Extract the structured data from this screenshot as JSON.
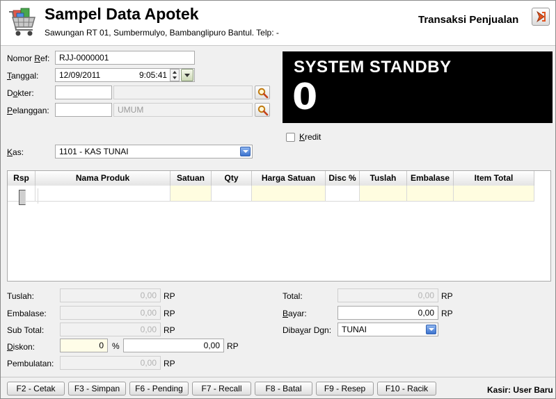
{
  "header": {
    "title": "Sampel Data Apotek",
    "subtitle": "Sawungan RT 01, Sumbermulyo, Bambanglipuro Bantul. Telp: -",
    "transaction_title": "Transaksi Penjualan",
    "logo_icon": "shopping-cart-icon",
    "exit_icon": "exit-arrow-icon"
  },
  "form": {
    "ref_label_pre": "Nomor ",
    "ref_label_key": "R",
    "ref_label_post": "ef:",
    "ref_value": "RJJ-0000001",
    "date_label_key": "T",
    "date_label_post": "anggal:",
    "date_value": "12/09/2011",
    "time_value": "9:05:41",
    "doctor_label_pre": "D",
    "doctor_label_key": "o",
    "doctor_label_post": "kter:",
    "doctor_code": "",
    "doctor_name": "",
    "customer_label_key": "P",
    "customer_label_post": "elanggan:",
    "customer_code": "",
    "customer_name": "UMUM",
    "kas_label_key": "K",
    "kas_label_post": "as:",
    "kas_value": "1101 - KAS TUNAI"
  },
  "display": {
    "status": "SYSTEM STANDBY",
    "value": "0"
  },
  "kredit": {
    "label_key": "K",
    "label_post": "redit",
    "checked": false
  },
  "grid": {
    "columns": [
      "Rsp",
      "Nama Produk",
      "Satuan",
      "Qty",
      "Harga Satuan",
      "Disc %",
      "Tuslah",
      "Embalase",
      "Item Total"
    ],
    "rows": [
      {
        "rsp": "",
        "nama_produk": "",
        "satuan": "",
        "qty": "",
        "harga_satuan": "",
        "disc": "",
        "tuslah": "",
        "embalase": "",
        "item_total": ""
      }
    ]
  },
  "summary_left": {
    "tuslah_label": "Tuslah:",
    "tuslah_value": "0,00",
    "embalase_label": "Embalase:",
    "embalase_value": "0,00",
    "subtotal_label": "Sub Total:",
    "subtotal_value": "0,00",
    "diskon_label_key": "D",
    "diskon_label_post": "iskon:",
    "diskon_percent": "0",
    "percent_sign": "%",
    "diskon_value": "0,00",
    "pembulatan_label": "Pembulatan:",
    "pembulatan_value": "0,00",
    "currency": "RP"
  },
  "summary_right": {
    "total_label": "Total:",
    "total_value": "0,00",
    "bayar_label_key": "B",
    "bayar_label_post": "ayar:",
    "bayar_value": "0,00",
    "dibayar_label_pre": "Diba",
    "dibayar_label_key": "y",
    "dibayar_label_post": "ar Dgn:",
    "dibayar_value": "TUNAI",
    "currency": "RP"
  },
  "footer": {
    "buttons": [
      "F2 - Cetak",
      "F3 - Simpan",
      "F6 - Pending",
      "F7 - Recall",
      "F8 - Batal",
      "F9 - Resep",
      "F10 - Racik"
    ],
    "kasir": "Kasir: User Baru"
  }
}
